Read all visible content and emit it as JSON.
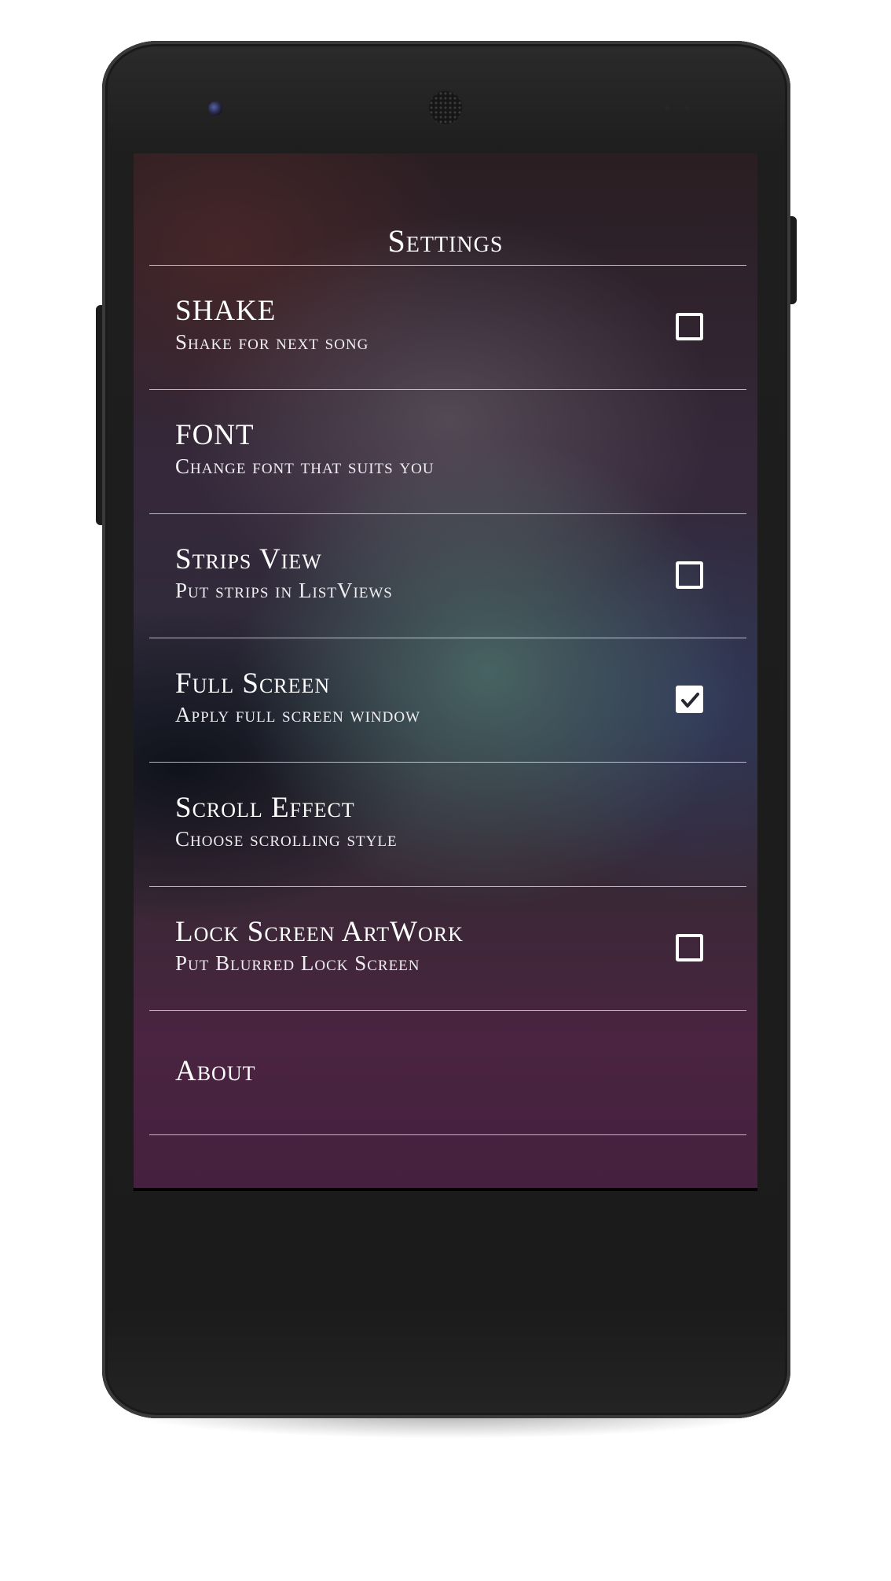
{
  "device": {
    "color": "#1d1d1d",
    "camera": "front-camera",
    "earpiece": "earpiece-grille"
  },
  "header": {
    "title": "Settings"
  },
  "settings": [
    {
      "title": "SHAKE",
      "subtitle": "Shake for next song",
      "has_checkbox": true,
      "checked": false
    },
    {
      "title": "FONT",
      "subtitle": "Change font that suits you",
      "has_checkbox": false
    },
    {
      "title": "Strips View",
      "subtitle": "Put strips in ListViews",
      "has_checkbox": true,
      "checked": false
    },
    {
      "title": "Full Screen",
      "subtitle": "Apply full screen window",
      "has_checkbox": true,
      "checked": true
    },
    {
      "title": "Scroll Effect",
      "subtitle": "Choose scrolling style",
      "has_checkbox": false
    },
    {
      "title": "Lock Screen ArtWork",
      "subtitle": "Put Blurred Lock Screen",
      "has_checkbox": true,
      "checked": false
    },
    {
      "title": "About",
      "subtitle": "",
      "has_checkbox": false
    }
  ],
  "navbar": {
    "back_icon": "back-triangle-icon",
    "home_icon": "home-circle-icon",
    "recents_icon": "recents-square-icon"
  },
  "colors": {
    "accent": "#ffffff",
    "divider": "#e0e0e6",
    "navbar": "#000000"
  }
}
